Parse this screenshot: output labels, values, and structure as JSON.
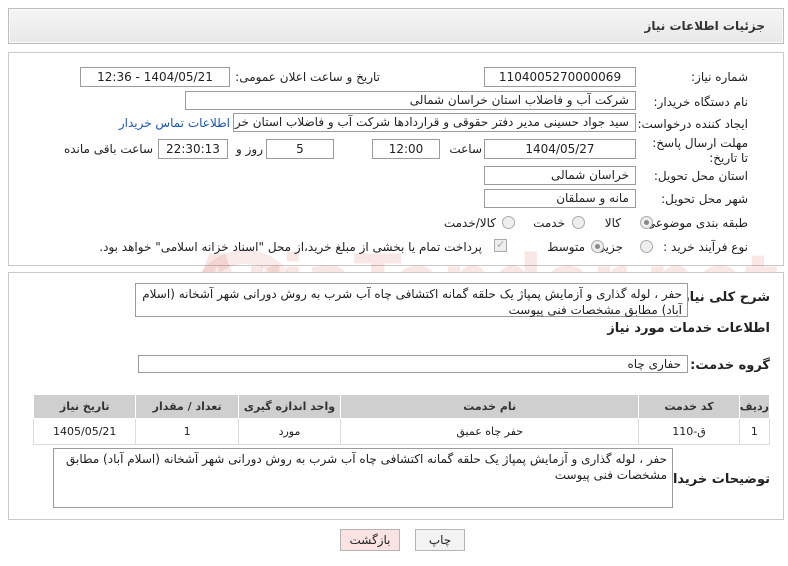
{
  "header": {
    "title": "جزئیات اطلاعات نیاز"
  },
  "need": {
    "number_label": "شماره نیاز:",
    "number_value": "1104005270000069",
    "announce_label": "تاریخ و ساعت اعلان عمومی:",
    "announce_value": "1404/05/21 - 12:36",
    "buyer_label": "نام دستگاه خریدار:",
    "buyer_value": "شرکت آب و فاضلاب استان خراسان شمالی",
    "creator_label": "ایجاد کننده درخواست:",
    "creator_value": "سید جواد حسینی مدیر دفتر حقوقی و قراردادها  شرکت آب و فاضلاب استان خراسان شمالی",
    "contact_link": "اطلاعات تماس خریدار",
    "deadline_label": "مهلت ارسال پاسخ: تا تاریخ:",
    "deadline_date": "1404/05/27",
    "hour_label": "ساعت",
    "deadline_hour": "12:00",
    "days_value": "5",
    "days_label": "روز و",
    "remaining_value": "22:30:13",
    "remaining_label": "ساعت باقی مانده",
    "province_label": "استان محل تحویل:",
    "province_value": "خراسان شمالی",
    "city_label": "شهر محل تحویل:",
    "city_value": "مانه و سملقان",
    "category_label": "طبقه بندی موضوعی:",
    "category_options": [
      "کالا",
      "خدمت",
      "کالا/خدمت"
    ],
    "category_selected": "کالا",
    "process_label": "نوع فرآیند خرید :",
    "process_options": [
      "جزیی",
      "متوسط"
    ],
    "process_selected": "متوسط",
    "payment_note": "پرداخت تمام یا بخشی از مبلغ خرید،از محل \"اسناد خزانه اسلامی\" خواهد بود."
  },
  "summary": {
    "label": "شرح کلی نیاز:",
    "text": "حفر ، لوله گذاری و آزمایش پمپاژ یک حلقه گمانه اکتشافی چاه آب شرب به روش دورانی شهر آشخانه (اسلام آباد) مطابق مشخصات فنی پیوست"
  },
  "services": {
    "title": "اطلاعات خدمات مورد نیاز",
    "group_label": "گروه خدمت:",
    "group_value": "حفاری چاه",
    "columns": [
      "ردیف",
      "کد خدمت",
      "نام خدمت",
      "واحد اندازه گیری",
      "تعداد / مقدار",
      "تاریخ نیاز"
    ],
    "rows": [
      [
        "1",
        "ق-110",
        "حفر چاه عمیق",
        "مورد",
        "1",
        "1405/05/21"
      ]
    ]
  },
  "buyer_notes": {
    "label": "توضیحات خریدار:",
    "text": "حفر ، لوله گذاری و آزمایش پمپاژ یک حلقه گمانه اکتشافی چاه آب شرب به روش دورانی شهر آشخانه (اسلام آباد) مطابق مشخصات فنی پیوست"
  },
  "buttons": {
    "print": "چاپ",
    "back": "بازگشت"
  },
  "watermark": "AriaTender.net",
  "colors": {
    "back_button_bg": "#fbe3e3",
    "link": "#1a55b3",
    "table_header": "#cfcfcf"
  }
}
